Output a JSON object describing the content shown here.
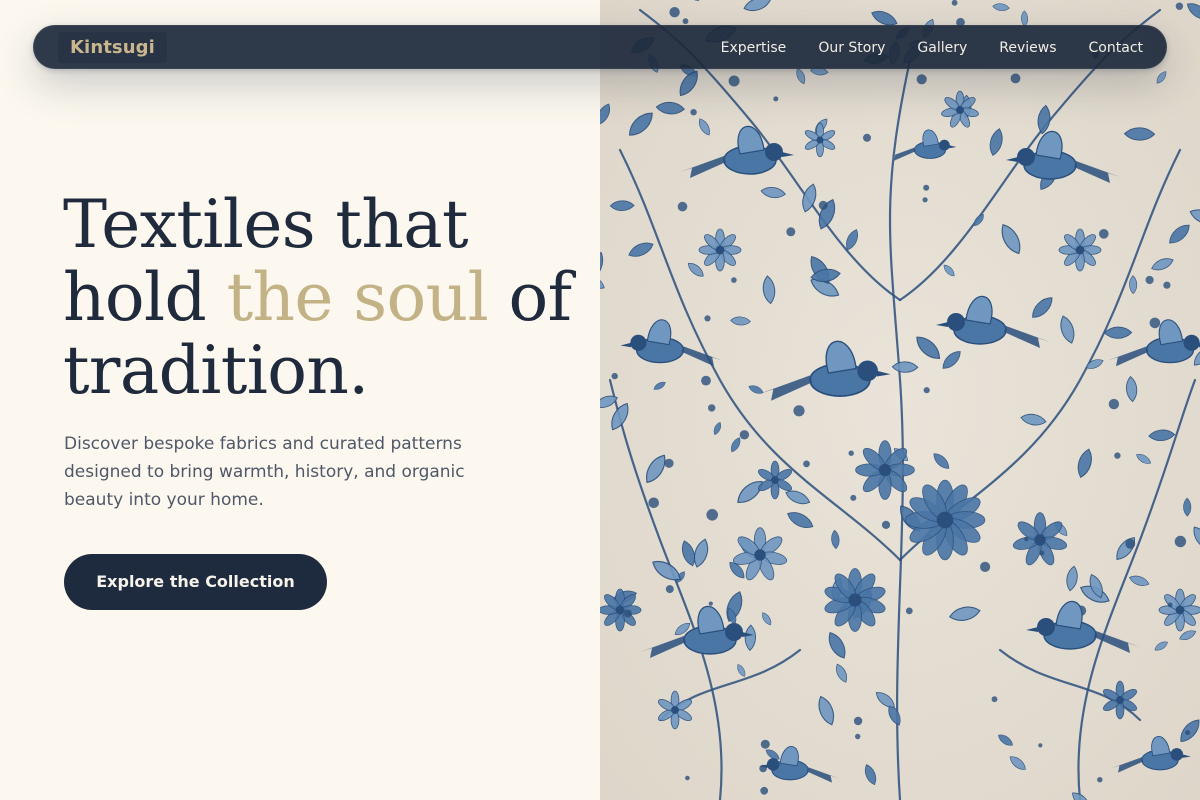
{
  "nav": {
    "brand": "Kintsugi",
    "links": [
      "Expertise",
      "Our Story",
      "Gallery",
      "Reviews",
      "Contact"
    ]
  },
  "hero": {
    "headline_part1": "Textiles that hold ",
    "headline_accent": "the soul",
    "headline_part2": " of tradition.",
    "subtext": "Discover bespoke fabrics and curated patterns designed to bring warmth, history, and organic beauty into your home.",
    "cta_label": "Explore the Collection",
    "image_subject": "blue botanical textile pattern with birds and flowers"
  },
  "colors": {
    "background": "#fcf8ef",
    "navy": "#1f2a3c",
    "gold_accent": "#c4b287",
    "fabric_base": "#e4ddd2",
    "fabric_blue_dark": "#2a4f7c",
    "fabric_blue_light": "#6f97c0"
  }
}
